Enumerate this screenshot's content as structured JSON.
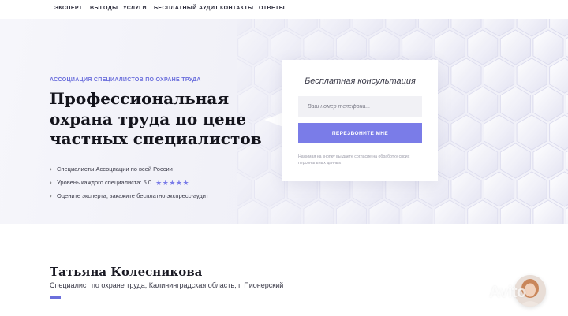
{
  "nav": {
    "items": [
      {
        "label": "ЭКСПЕРТ"
      },
      {
        "label": "ВЫГОДЫ"
      },
      {
        "label": "УСЛУГИ"
      },
      {
        "label": "БЕСПЛАТНЫЙ АУДИТ"
      },
      {
        "label": "КОНТАКТЫ"
      },
      {
        "label": "ОТВЕТЫ"
      }
    ]
  },
  "hero": {
    "eyebrow": "АССОЦИАЦИЯ СПЕЦИАЛИСТОВ ПО ОХРАНЕ ТРУДА",
    "headline": {
      "line1": "Профессиональная",
      "line2": "охрана труда по цене",
      "line3": "частных специалистов"
    },
    "bullets": [
      {
        "text": "Специалисты Ассоциации по всей России"
      },
      {
        "text": "Уровень каждого специалиста: 5.0",
        "rating": 5
      },
      {
        "text": "Оцените эксперта, закажите бесплатно экспресс-аудит"
      }
    ],
    "bullet_icon": "chevron-right-icon",
    "star_icon": "star-icon"
  },
  "form": {
    "title": "Бесплатная консультация",
    "phone_placeholder": "Ваш номер телефона...",
    "button_label": "ПЕРЕЗВОНИТЕ МНЕ",
    "consent": "Нажимая на кнопку вы даете согласие на обработку своих персональных данных"
  },
  "profile": {
    "name": "Татьяна Колесникова",
    "subtitle": "Специалист по охране труда, Калининградская область, г. Пионерский"
  },
  "watermark": "Avito",
  "colors": {
    "accent": "#6b6fdc",
    "button": "#7a7ce8",
    "hero_bg": "#f1f1f8",
    "text_dark": "#14141c"
  }
}
